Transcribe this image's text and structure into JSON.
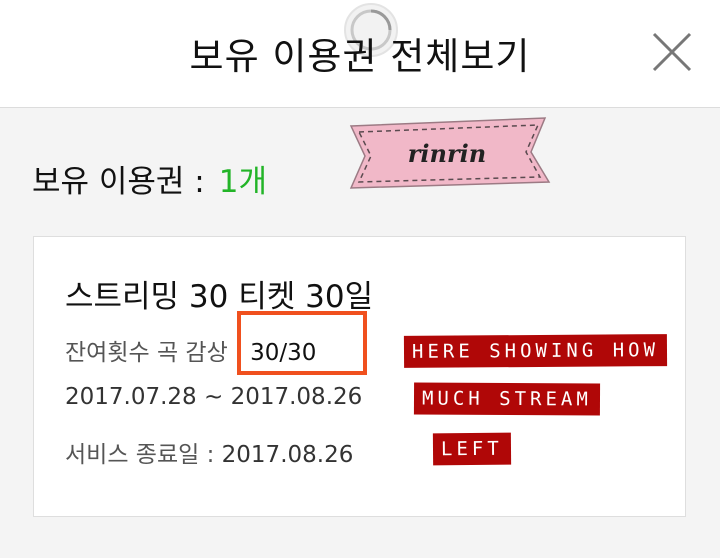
{
  "header": {
    "title": "보유 이용권 전체보기"
  },
  "summary": {
    "label": "보유 이용권 :",
    "count": "1개",
    "count_color": "#22b427"
  },
  "sticker": {
    "text": "rinrin",
    "color": "#f1b8c8"
  },
  "ticket": {
    "name": "스트리밍 30 티켓 30일",
    "remaining_label": "잔여횟수 곡 감상 :",
    "remaining_value": "30/30",
    "period": "2017.07.28 ~ 2017.08.26",
    "end_label": "서비스 종료일 :",
    "end_date": "2017.08.26"
  },
  "annotation": {
    "highlight_color": "#f0501e",
    "tape_color": "#b00707",
    "lines": [
      "HERE SHOWING HOW",
      "MUCH STREAM",
      "LEFT"
    ]
  },
  "icons": {
    "close": "close-icon",
    "loading": "loading-spinner-icon"
  }
}
